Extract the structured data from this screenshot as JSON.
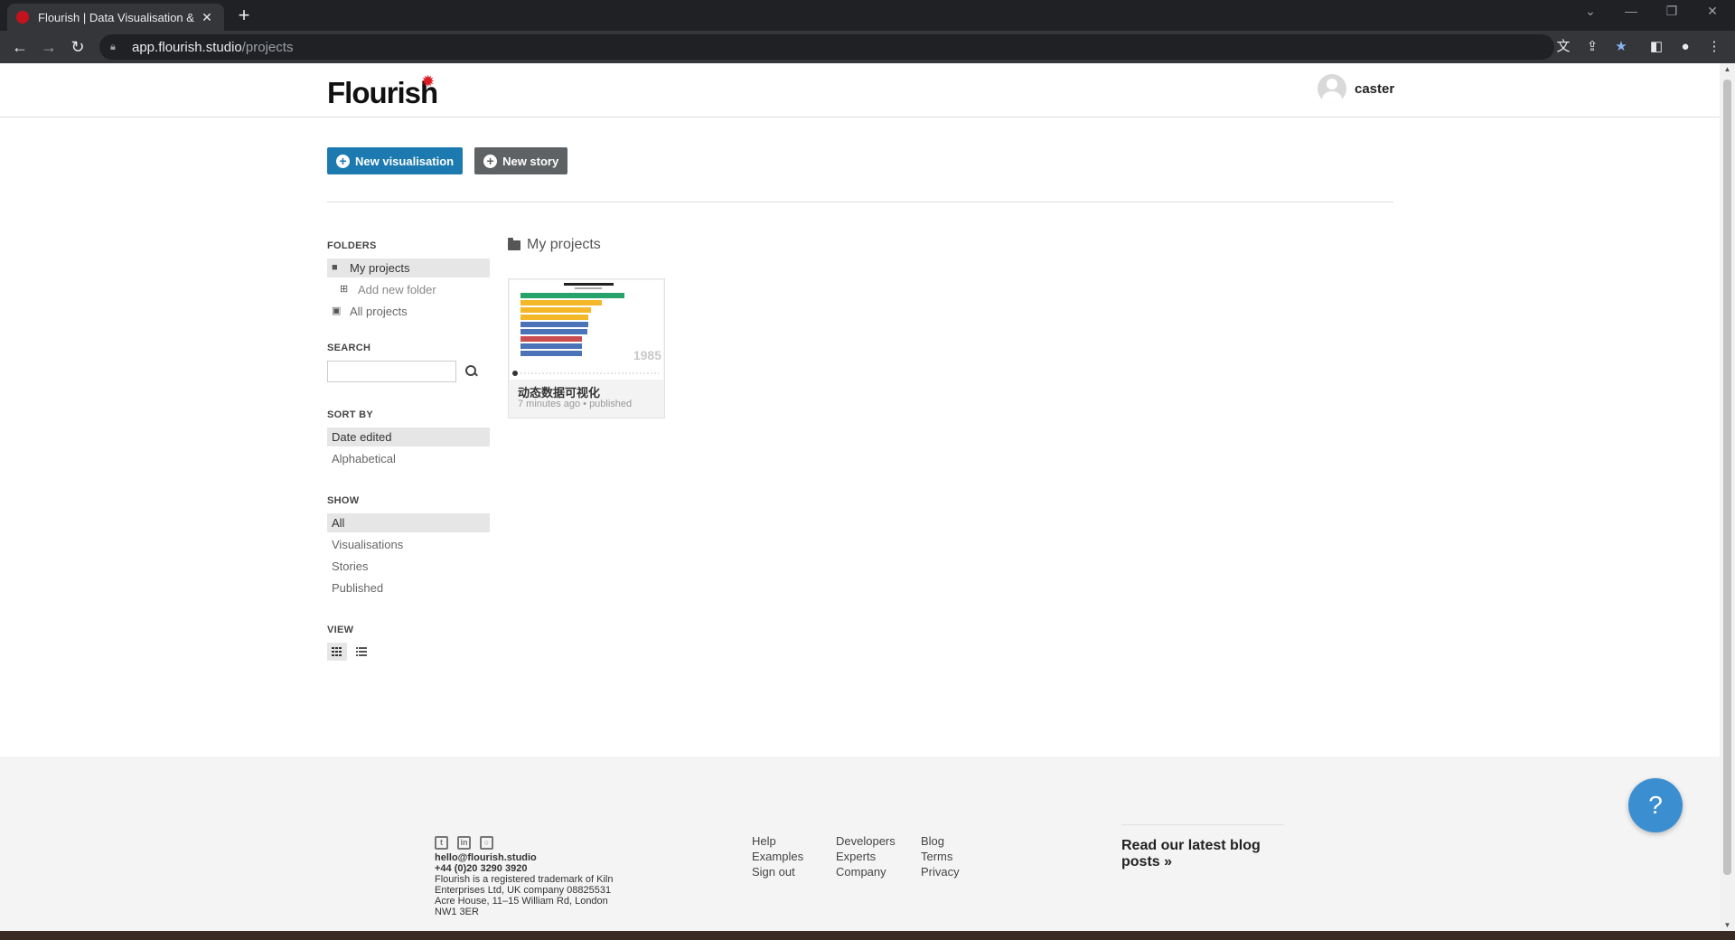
{
  "browser": {
    "tab_title": "Flourish | Data Visualisation &",
    "url_host": "app.flourish.studio",
    "url_path": "/projects"
  },
  "header": {
    "logo": "Flourish",
    "username": "caster"
  },
  "actions": {
    "new_visualisation": "New visualisation",
    "new_story": "New story"
  },
  "sidebar": {
    "folders_heading": "FOLDERS",
    "folders": {
      "my_projects": "My projects",
      "add_new_folder": "Add new folder",
      "all_projects": "All projects"
    },
    "search_heading": "SEARCH",
    "search_value": "",
    "sort_heading": "SORT BY",
    "sort_options": [
      "Date edited",
      "Alphabetical"
    ],
    "sort_selected": "Date edited",
    "show_heading": "SHOW",
    "show_options": [
      "All",
      "Visualisations",
      "Stories",
      "Published"
    ],
    "show_selected": "All",
    "view_heading": "VIEW",
    "view_selected": "grid"
  },
  "content": {
    "title": "My projects",
    "projects": [
      {
        "title": "动态数据可视化",
        "meta": "7 minutes ago • published",
        "thumbnail_year": "1985",
        "thumbnail_bar_colors": [
          "#27a26b",
          "#f4b728",
          "#f4b728",
          "#f4b728",
          "#4a73b8",
          "#4a73b8",
          "#c94c50",
          "#4a73b8",
          "#4a73b8"
        ]
      }
    ]
  },
  "footer": {
    "email": "hello@flourish.studio",
    "phone": "+44 (0)20 3290 3920",
    "legal_1": "Flourish is a registered trademark of Kiln Enterprises Ltd, UK company 08825531",
    "legal_2": "Acre House, 11–15 William Rd, London NW1 3ER",
    "col1": [
      "Help",
      "Examples",
      "Sign out"
    ],
    "col2": [
      "Developers",
      "Experts",
      "Company"
    ],
    "col3": [
      "Blog",
      "Terms",
      "Privacy"
    ],
    "blog_cta": "Read our latest blog posts »"
  },
  "help_button": "?"
}
